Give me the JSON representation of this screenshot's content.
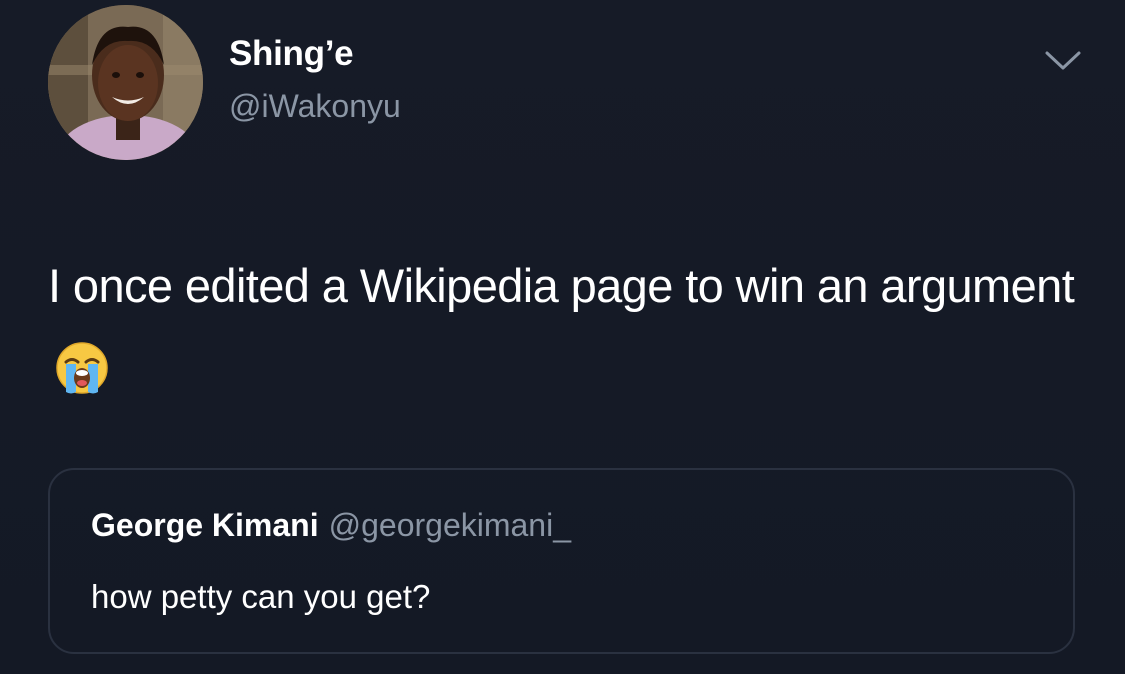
{
  "tweet": {
    "author": {
      "display_name": "Shing’e",
      "handle": "@iWakonyu",
      "avatar_icon": "profile-photo"
    },
    "menu_icon": "chevron-down-icon",
    "text": "I once edited a Wikipedia page to win an argument",
    "emoji": "loudly-crying-face-emoji",
    "quoted": {
      "display_name": "George Kimani",
      "handle": "@georgekimani_",
      "text": "how petty can you get?"
    }
  },
  "colors": {
    "background": "#151a25",
    "primary_text": "#ffffff",
    "secondary_text": "#8b96a5",
    "card_border": "#2a3140"
  }
}
